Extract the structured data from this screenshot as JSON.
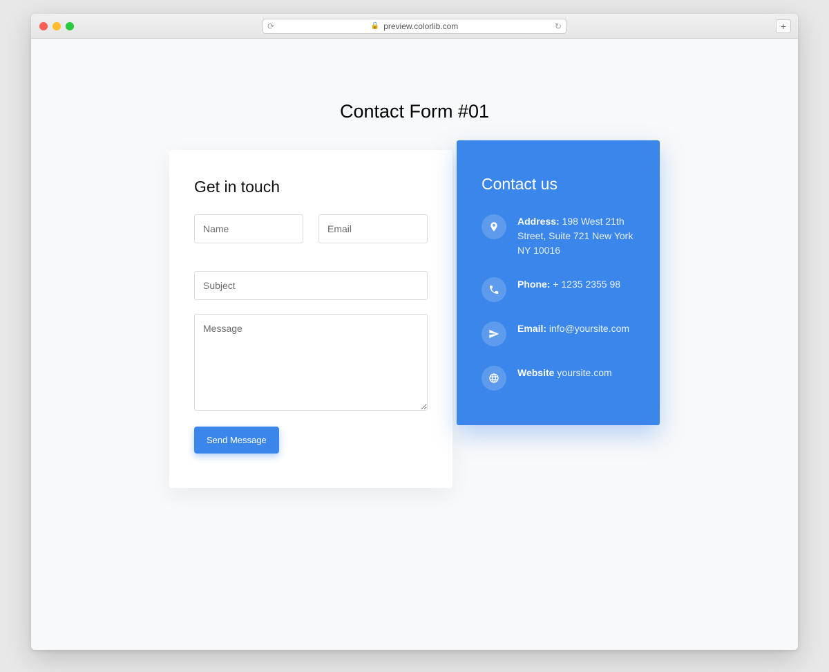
{
  "browser": {
    "url": "preview.colorlib.com"
  },
  "page": {
    "title": "Contact Form #01"
  },
  "form": {
    "heading": "Get in touch",
    "name_placeholder": "Name",
    "email_placeholder": "Email",
    "subject_placeholder": "Subject",
    "message_placeholder": "Message",
    "submit_label": "Send Message"
  },
  "contact": {
    "heading": "Contact us",
    "address_label": "Address:",
    "address_value": " 198 West 21th Street, Suite 721 New York NY 10016",
    "phone_label": "Phone:",
    "phone_value": " + 1235 2355 98",
    "email_label": "Email:",
    "email_value": " info@yoursite.com",
    "website_label": "Website",
    "website_value": " yoursite.com"
  }
}
